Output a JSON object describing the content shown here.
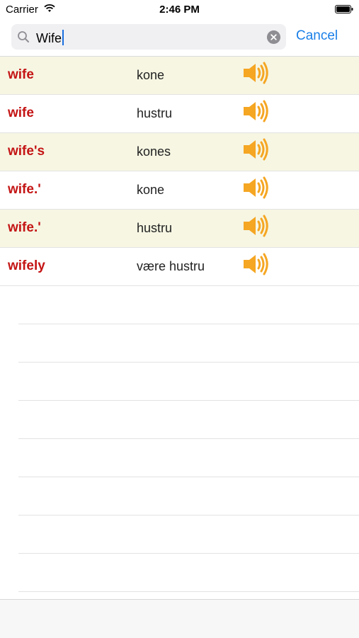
{
  "status_bar": {
    "carrier": "Carrier",
    "time": "2:46 PM",
    "icons": [
      "wifi-icon",
      "battery-icon"
    ]
  },
  "search": {
    "value": "Wife",
    "cancel_label": "Cancel",
    "icons": [
      "search-icon",
      "clear-icon"
    ]
  },
  "results": [
    {
      "word": "wife",
      "translation": "kone"
    },
    {
      "word": "wife",
      "translation": "hustru"
    },
    {
      "word": "wife's",
      "translation": "kones"
    },
    {
      "word": "wife.'",
      "translation": "kone"
    },
    {
      "word": "wife.'",
      "translation": "hustru"
    },
    {
      "word": "wifely",
      "translation": "være hustru"
    }
  ],
  "colors": {
    "word": "#c41414",
    "alt_row": "#f6f6e3",
    "speaker": "#f5a623",
    "accent": "#1a7fe8"
  },
  "row_icon": "speaker-icon"
}
